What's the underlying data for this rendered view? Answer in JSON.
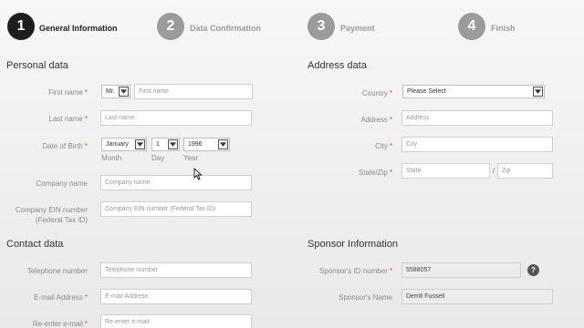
{
  "steps": [
    {
      "number": "1",
      "label": "General Information"
    },
    {
      "number": "2",
      "label": "Data Confirmation"
    },
    {
      "number": "3",
      "label": "Payment"
    },
    {
      "number": "4",
      "label": "Finish"
    }
  ],
  "personal": {
    "title": "Personal data",
    "first_name": {
      "label": "First name",
      "title_value": "Mr.",
      "placeholder": "First name"
    },
    "last_name": {
      "label": "Last name",
      "placeholder": "Last name"
    },
    "dob": {
      "label": "Date of Birth",
      "month": "January",
      "day": "1",
      "year": "1996",
      "month_label": "Month",
      "day_label": "Day",
      "year_label": "Year"
    },
    "company_name": {
      "label": "Company name",
      "placeholder": "Company name"
    },
    "company_ein": {
      "label_line1": "Company EIN number",
      "label_line2": "(Federal Tax ID)",
      "placeholder": "Company EIN number (Federal Tax ID)"
    }
  },
  "address": {
    "title": "Address data",
    "country": {
      "label": "Country",
      "value": "Please Select"
    },
    "address": {
      "label": "Address",
      "placeholder": "Address"
    },
    "city": {
      "label": "City",
      "placeholder": "City"
    },
    "state_zip": {
      "label": "State/Zip",
      "state_placeholder": "State",
      "slash": "/",
      "zip_placeholder": "Zip"
    }
  },
  "contact": {
    "title": "Contact data",
    "telephone": {
      "label": "Telephone number",
      "placeholder": "Telephone number"
    },
    "email": {
      "label": "E-mail Address",
      "placeholder": "E-mail Address"
    },
    "reemail": {
      "label": "Re-enter e-mail",
      "placeholder": "Re-enter e-mail"
    }
  },
  "sponsor": {
    "title": "Sponsor Information",
    "id": {
      "label": "Sponsor's ID number",
      "value": "5588057",
      "help": "?"
    },
    "name": {
      "label": "Sponsor's Name",
      "value": "Derrill Fussell"
    }
  },
  "required_mark": "*",
  "icons": {
    "caret": "chevron-down-icon",
    "help": "question-icon",
    "cursor": "mouse-cursor-icon"
  },
  "colors": {
    "active_step": "#1e1e1e",
    "inactive_step": "#9b9b9b",
    "required": "#d9534f"
  }
}
